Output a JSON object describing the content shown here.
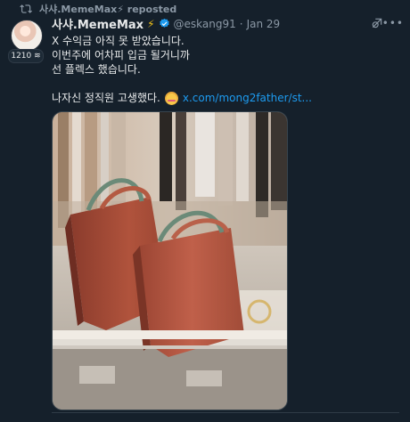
{
  "repost": {
    "icon": "repost-icon",
    "label": "사샤.MemeMax⚡ reposted"
  },
  "tweet": {
    "avatar_icon": "avatar",
    "follower_badge": "1210 ≋",
    "display_name": "사샤.MemeMax",
    "name_emoji": "⚡",
    "verified_icon": "verified-badge-icon",
    "handle": "@eskang91",
    "separator": "·",
    "timestamp": "Jan 29",
    "grok_icon": "grok-icon",
    "more_icon": "more-options-icon",
    "lines": [
      "X 수익금 아직 못 받았습니다.",
      "이번주에 어차피 입금 될거니까",
      "선 플렉스 했습니다."
    ],
    "closing_text": "나자신 정직원 고생했다.",
    "closing_emoji_icon": "smiling-face-with-hearts-icon",
    "link_text": "x.com/mong2father/st...",
    "media_icon": "photo-shopping-bags"
  },
  "colors": {
    "background": "#15202b",
    "text_primary": "#e7e9ea",
    "text_secondary": "#8b98a5",
    "link": "#1d9bf0",
    "verified": "#1d9bf0",
    "bolt": "#f5c518"
  }
}
